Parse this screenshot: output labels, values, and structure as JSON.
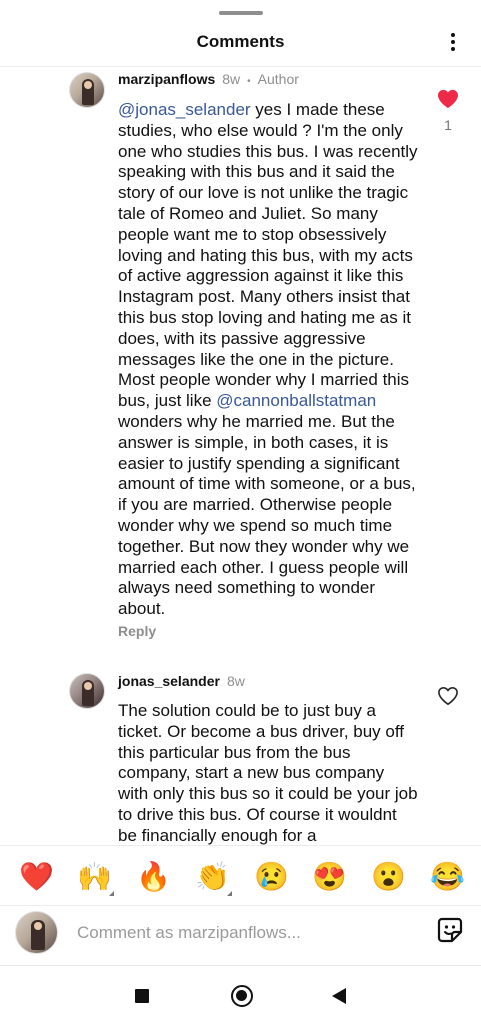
{
  "header": {
    "title": "Comments",
    "more_icon": "more-vertical-icon"
  },
  "comments": [
    {
      "username": "marzipanflows",
      "time": "8w",
      "separator": "•",
      "badge": "Author",
      "mention": "@jonas_selander",
      "text_part1": " yes I made these studies, who else would ? I'm the only one who studies this bus. I was recently speaking with this bus and it said the story of our love is not unlike the tragic tale of Romeo and Juliet. So many people want me to stop obsessively loving and hating this bus, with my acts of active aggression against it like this Instagram post. Many others insist that this bus stop loving and hating me as it does, with its passive aggressive messages like the one in the picture. Most people wonder why I married this bus, just like ",
      "mention2": "@cannonballstatman",
      "text_part2": " wonders why he married me. But the answer is simple, in both cases, it is easier to justify spending a significant amount of time with someone, or a bus, if you are married. Otherwise people wonder why we spend so much time together. But now they wonder why we married each other. I guess people will always need something to wonder about.",
      "reply_label": "Reply",
      "liked": true,
      "like_count": "1",
      "like_color": "#ed2a47"
    },
    {
      "username": "jonas_selander",
      "time": "8w",
      "text": "The solution could be to just buy a ticket. Or become a bus driver, buy off this particular bus from the bus company, start a new bus company with only this bus so it could be your job to drive this bus. Of course it wouldnt be financially enough for a",
      "liked": false
    }
  ],
  "reactions": [
    {
      "emoji": "❤️",
      "name": "red-heart-emoji"
    },
    {
      "emoji": "🙌",
      "name": "raising-hands-emoji",
      "has_variants": true
    },
    {
      "emoji": "🔥",
      "name": "fire-emoji"
    },
    {
      "emoji": "👏",
      "name": "clapping-hands-emoji",
      "has_variants": true
    },
    {
      "emoji": "😢",
      "name": "crying-face-emoji"
    },
    {
      "emoji": "😍",
      "name": "heart-eyes-emoji"
    },
    {
      "emoji": "😮",
      "name": "surprised-face-emoji"
    },
    {
      "emoji": "😂",
      "name": "tears-of-joy-emoji"
    }
  ],
  "composer": {
    "placeholder": "Comment as marzipanflows...",
    "sticker_icon": "sticker-icon"
  },
  "nav": {
    "recents_icon": "recents-square-icon",
    "home_icon": "home-circle-icon",
    "back_icon": "back-triangle-icon"
  },
  "colors": {
    "mention": "#385898",
    "like": "#ed2a47",
    "muted": "#8e8e8e"
  }
}
